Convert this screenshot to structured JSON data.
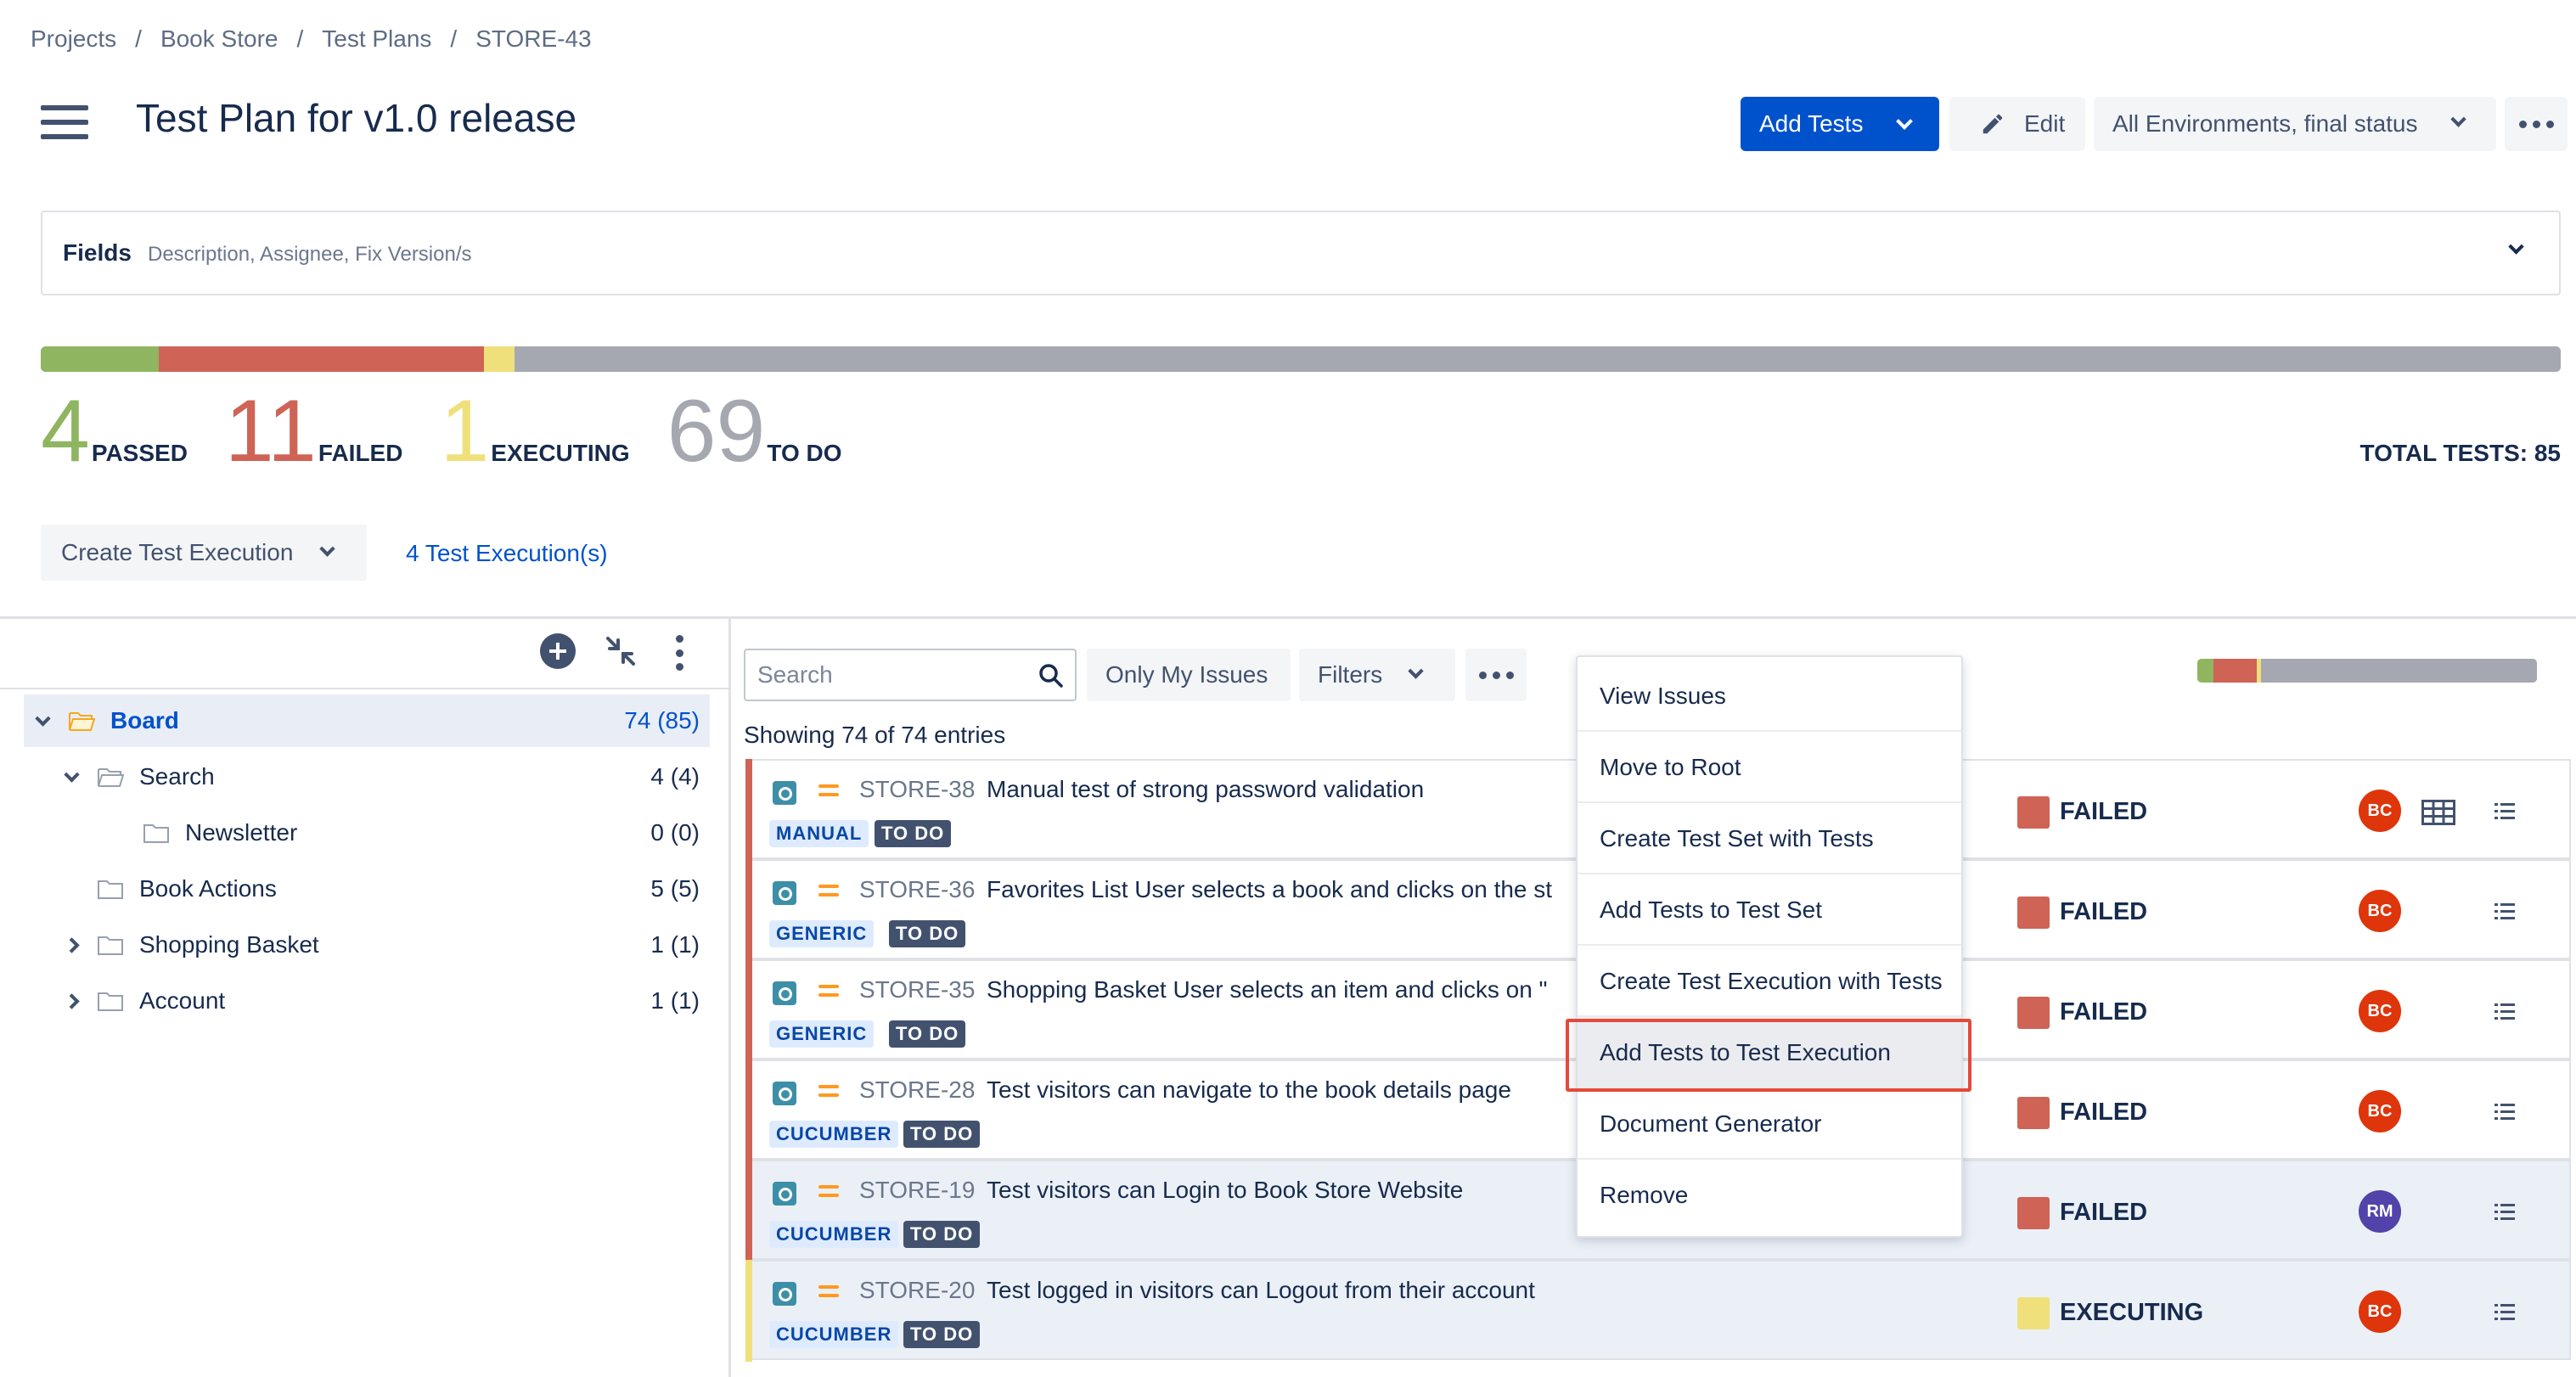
{
  "breadcrumb": [
    "Projects",
    "Book Store",
    "Test Plans",
    "STORE-43"
  ],
  "header": {
    "title": "Test Plan for v1.0 release",
    "add_tests_label": "Add Tests",
    "edit_label": "Edit",
    "environment_label": "All Environments, final status"
  },
  "fields": {
    "label": "Fields",
    "description": "Description, Assignee, Fix Version/s"
  },
  "progress": {
    "passed_fraction": 0.047,
    "failed_fraction": 0.129,
    "executing_fraction": 0.012,
    "todo_fraction": 0.812
  },
  "colors": {
    "passed": "#8fb561",
    "failed": "#cf6356",
    "executing": "#efe07c",
    "todo": "#a5a8b0",
    "accent": "#0052cc"
  },
  "counters": {
    "passed": {
      "value": "4",
      "label": "PASSED"
    },
    "failed": {
      "value": "11",
      "label": "FAILED"
    },
    "executing": {
      "value": "1",
      "label": "EXECUTING"
    },
    "todo": {
      "value": "69",
      "label": "TO DO"
    }
  },
  "total_tests": "TOTAL TESTS: 85",
  "execution": {
    "create_label": "Create Test Execution",
    "link_label": "4 Test Execution(s)"
  },
  "tree": [
    {
      "name": "Board",
      "count": "74 (85)",
      "level": 0,
      "expander": "down",
      "selected": true
    },
    {
      "name": "Search",
      "count": "4 (4)",
      "level": 1,
      "expander": "down",
      "selected": false
    },
    {
      "name": "Newsletter",
      "count": "0 (0)",
      "level": 2,
      "expander": "none",
      "selected": false
    },
    {
      "name": "Book Actions",
      "count": "5 (5)",
      "level": 1,
      "expander": "none",
      "selected": false
    },
    {
      "name": "Shopping Basket",
      "count": "1 (1)",
      "level": 1,
      "expander": "right",
      "selected": false
    },
    {
      "name": "Account",
      "count": "1 (1)",
      "level": 1,
      "expander": "right",
      "selected": false
    }
  ],
  "toolbar": {
    "search_placeholder": "Search",
    "only_my_issues_label": "Only My Issues",
    "filters_label": "Filters"
  },
  "showing": "Showing 74 of 74 entries",
  "tests": [
    {
      "key": "STORE-38",
      "summary": "Manual test of strong password validation",
      "type": "MANUAL",
      "tag": "TO DO",
      "status": "FAILED",
      "assignee": "BC",
      "assignee_color": "#de350b",
      "highlight": false
    },
    {
      "key": "STORE-36",
      "summary": "Favorites List User selects a book and clicks on the st",
      "type": "GENERIC",
      "tag": "TO DO",
      "status": "FAILED",
      "assignee": "BC",
      "assignee_color": "#de350b",
      "highlight": false
    },
    {
      "key": "STORE-35",
      "summary": "Shopping Basket User selects an item and clicks on \"",
      "type": "GENERIC",
      "tag": "TO DO",
      "status": "FAILED",
      "assignee": "BC",
      "assignee_color": "#de350b",
      "highlight": false
    },
    {
      "key": "STORE-28",
      "summary": "Test visitors can navigate to the book details page",
      "type": "CUCUMBER",
      "tag": "TO DO",
      "status": "FAILED",
      "assignee": "BC",
      "assignee_color": "#de350b",
      "highlight": false
    },
    {
      "key": "STORE-19",
      "summary": "Test visitors can Login to Book Store Website",
      "type": "CUCUMBER",
      "tag": "TO DO",
      "status": "FAILED",
      "assignee": "RM",
      "assignee_color": "#5243aa",
      "highlight": true
    },
    {
      "key": "STORE-20",
      "summary": "Test logged in visitors can Logout from their account",
      "type": "CUCUMBER",
      "tag": "TO DO",
      "status": "EXECUTING",
      "assignee": "BC",
      "assignee_color": "#de350b",
      "highlight": true
    }
  ],
  "context_menu": [
    "View Issues",
    "Move to Root",
    "Create Test Set with Tests",
    "Add Tests to Test Set",
    "Create Test Execution with Tests",
    "Add Tests to Test Execution",
    "Document Generator",
    "Remove"
  ],
  "context_menu_active": 5
}
